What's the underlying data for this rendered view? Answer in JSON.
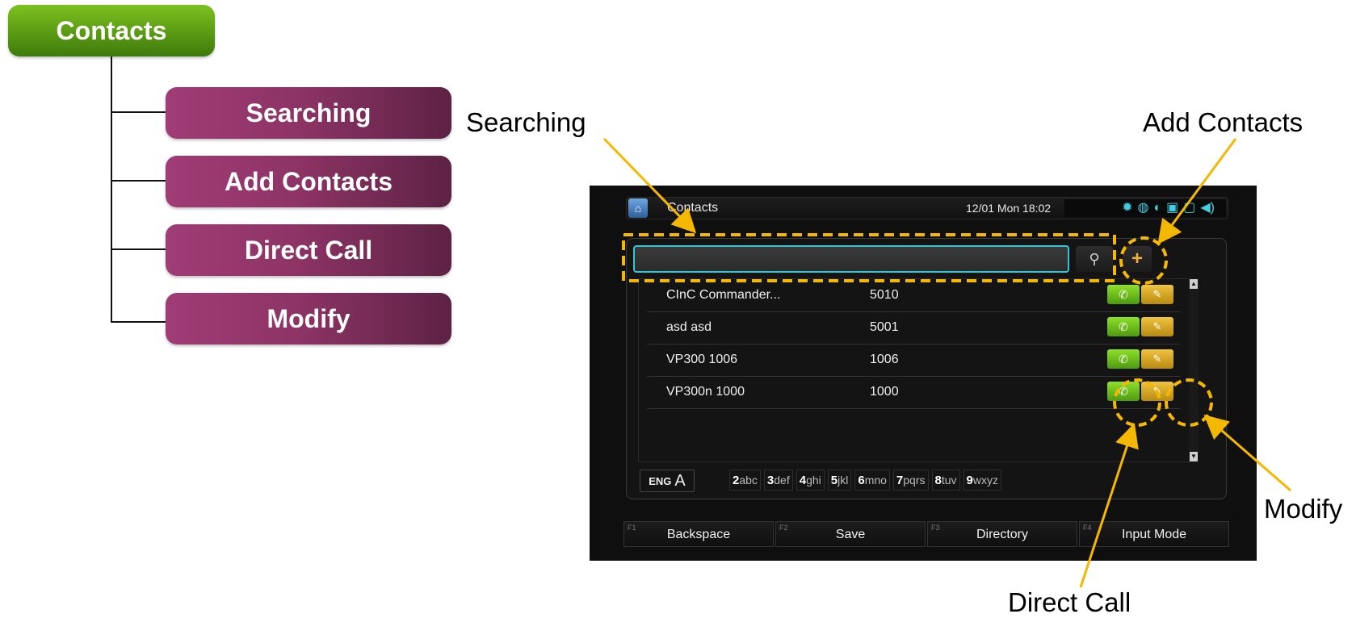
{
  "tree": {
    "root": "Contacts",
    "branches": [
      "Searching",
      "Add Contacts",
      "Direct Call",
      "Modify"
    ]
  },
  "callouts": {
    "searching": "Searching",
    "add_contacts": "Add Contacts",
    "direct_call": "Direct Call",
    "modify": "Modify"
  },
  "screen": {
    "title": "Contacts",
    "datetime": "12/01 Mon 18:02",
    "status_icons": [
      "gear-icon",
      "globe-icon",
      "headset-icon",
      "calendar-icon",
      "chat-icon",
      "speaker-icon"
    ],
    "search": {
      "value": "",
      "placeholder": ""
    },
    "add_symbol": "+",
    "contacts": [
      {
        "name": "CInC Commander...",
        "number": "5010"
      },
      {
        "name": "asd asd",
        "number": "5001"
      },
      {
        "name": "VP300  1006",
        "number": "1006"
      },
      {
        "name": "VP300n  1000",
        "number": "1000"
      }
    ],
    "ime": {
      "lang_small": "ENG",
      "lang_big": "A",
      "keys": [
        {
          "digit": "2",
          "letters": "abc"
        },
        {
          "digit": "3",
          "letters": "def"
        },
        {
          "digit": "4",
          "letters": "ghi"
        },
        {
          "digit": "5",
          "letters": "jkl"
        },
        {
          "digit": "6",
          "letters": "mno"
        },
        {
          "digit": "7",
          "letters": "pqrs"
        },
        {
          "digit": "8",
          "letters": "tuv"
        },
        {
          "digit": "9",
          "letters": "wxyz"
        }
      ]
    },
    "function_keys": [
      {
        "key": "F1",
        "label": "Backspace"
      },
      {
        "key": "F2",
        "label": "Save"
      },
      {
        "key": "F3",
        "label": "Directory"
      },
      {
        "key": "F4",
        "label": "Input Mode"
      }
    ]
  },
  "colors": {
    "callout_dash": "#f5b800",
    "root_green": "#5a9a14",
    "branch_purple": "#8e3466",
    "search_border": "#34c6d4"
  }
}
